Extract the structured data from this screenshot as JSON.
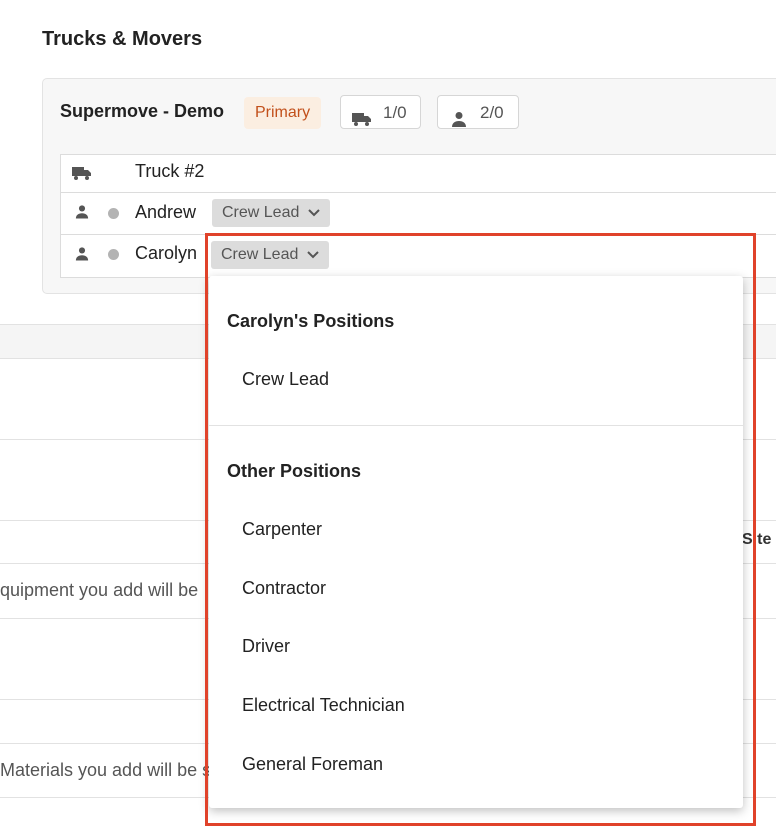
{
  "section": {
    "title": "Trucks & Movers"
  },
  "organization": {
    "name": "Supermove - Demo",
    "badge": "Primary",
    "trucks_count": "1/0",
    "movers_count": "2/0"
  },
  "crew": {
    "truck": {
      "label": "Truck #2",
      "icon": "truck-icon"
    },
    "movers": [
      {
        "name": "Andrew",
        "position": "Crew Lead"
      },
      {
        "name": "Carolyn",
        "position": "Crew Lead"
      }
    ]
  },
  "background": {
    "site_label": "Site",
    "equipment_hint": "quipment you add will be",
    "materials_hint": "Materials you add will be s"
  },
  "dropdown": {
    "own_header": "Carolyn's Positions",
    "own_items": [
      "Crew Lead"
    ],
    "other_header": "Other Positions",
    "other_items": [
      "Carpenter",
      "Contractor",
      "Driver",
      "Electrical Technician",
      "General Foreman"
    ]
  },
  "colors": {
    "badge_text": "#c2501b",
    "badge_bg": "#fbeee1",
    "highlight_border": "#e0422a"
  }
}
